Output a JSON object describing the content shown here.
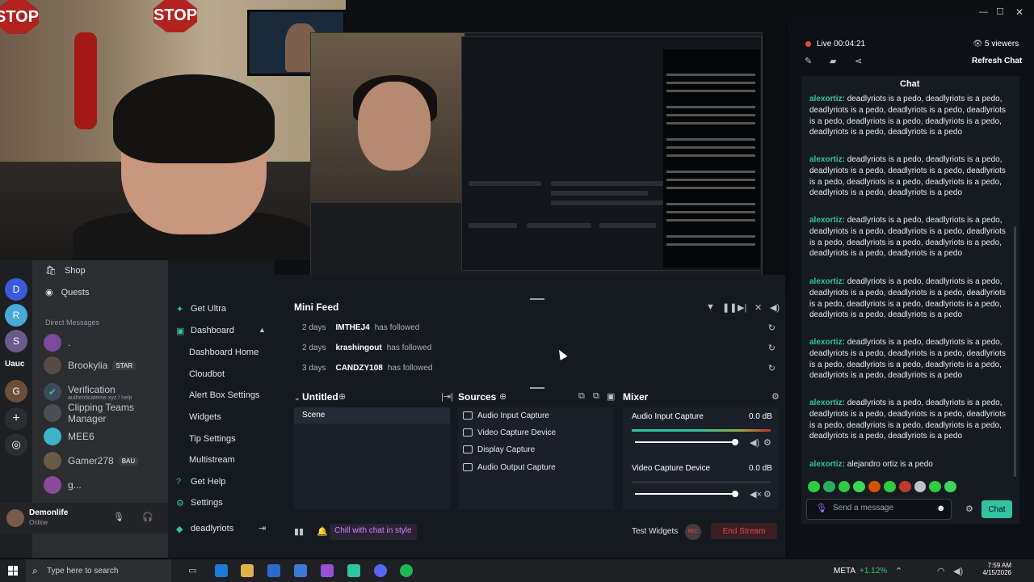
{
  "window": {
    "controls": [
      "—",
      "☐",
      "✕"
    ]
  },
  "stream": {
    "status": "Live",
    "time": "00:04:21",
    "viewers": "5 viewers",
    "refresh": "Refresh Chat",
    "chat_title": "Chat"
  },
  "chat": {
    "messages": [
      {
        "user": "alexortiz",
        "text": "deadlyriots is a pedo, deadlyriots is a pedo, deadlyriots is a pedo, deadlyriots is a pedo, deadlyriots is a pedo, deadlyriots is a pedo, deadlyriots is a pedo, deadlyriots is a pedo, deadlyriots is a pedo"
      },
      {
        "user": "alexortiz",
        "text": "deadlyriots is a pedo, deadlyriots is a pedo, deadlyriots is a pedo, deadlyriots is a pedo, deadlyriots is a pedo, deadlyriots is a pedo, deadlyriots is a pedo, deadlyriots is a pedo, deadlyriots is a pedo"
      },
      {
        "user": "alexortiz",
        "text": "deadlyriots is a pedo, deadlyriots is a pedo, deadlyriots is a pedo, deadlyriots is a pedo, deadlyriots is a pedo, deadlyriots is a pedo, deadlyriots is a pedo, deadlyriots is a pedo, deadlyriots is a pedo"
      },
      {
        "user": "alexortiz",
        "text": "deadlyriots is a pedo, deadlyriots is a pedo, deadlyriots is a pedo, deadlyriots is a pedo, deadlyriots is a pedo, deadlyriots is a pedo, deadlyriots is a pedo, deadlyriots is a pedo, deadlyriots is a pedo"
      },
      {
        "user": "alexortiz",
        "text": "deadlyriots is a pedo, deadlyriots is a pedo, deadlyriots is a pedo, deadlyriots is a pedo, deadlyriots is a pedo, deadlyriots is a pedo, deadlyriots is a pedo, deadlyriots is a pedo, deadlyriots is a pedo"
      },
      {
        "user": "alexortiz",
        "text": "deadlyriots is a pedo, deadlyriots is a pedo, deadlyriots is a pedo, deadlyriots is a pedo, deadlyriots is a pedo, deadlyriots is a pedo, deadlyriots is a pedo, deadlyriots is a pedo, deadlyriots is a pedo"
      },
      {
        "user": "alexortiz",
        "text": "alejandro ortiz is a pedo"
      }
    ],
    "input_placeholder": "Send a message",
    "send_label": "Chat"
  },
  "discord": {
    "items": [
      {
        "label": "Shop"
      },
      {
        "label": "Quests"
      }
    ],
    "dm_header": "Direct Messages",
    "dms": [
      {
        "name": ".",
        "sub": "",
        "badge": ""
      },
      {
        "name": "Brookylia",
        "sub": "",
        "badge": "STAR"
      },
      {
        "name": "Verification",
        "sub": "authenticateme.xyz / help",
        "badge": ""
      },
      {
        "name": "Clipping Teams Manager",
        "sub": "",
        "badge": ""
      },
      {
        "name": "MEE6",
        "sub": "",
        "badge": ""
      },
      {
        "name": "Gamer278",
        "sub": "",
        "badge": "BAU"
      },
      {
        "name": "g...",
        "sub": "",
        "badge": ""
      }
    ],
    "rail_label": "Uauc",
    "user": {
      "name": "Demonlife",
      "status": "Online"
    }
  },
  "obs_nav": {
    "items": [
      {
        "label": "Get Ultra",
        "sub": false
      },
      {
        "label": "Dashboard",
        "sub": false
      },
      {
        "label": "Dashboard Home",
        "sub": true
      },
      {
        "label": "Cloudbot",
        "sub": true
      },
      {
        "label": "Alert Box Settings",
        "sub": true
      },
      {
        "label": "Widgets",
        "sub": true
      },
      {
        "label": "Tip Settings",
        "sub": true
      },
      {
        "label": "Multistream",
        "sub": true
      },
      {
        "label": "Get Help",
        "sub": false
      },
      {
        "label": "Settings",
        "sub": false
      }
    ],
    "account": "deadlyriots"
  },
  "minifeed": {
    "title": "Mini Feed",
    "rows": [
      {
        "time": "2 days",
        "user": "IMTHEJ4",
        "action": "has followed"
      },
      {
        "time": "2 days",
        "user": "krashingout",
        "action": "has followed"
      },
      {
        "time": "3 days",
        "user": "CANDZY108",
        "action": "has followed"
      }
    ]
  },
  "scenes": {
    "title": "Untitled",
    "items": [
      "Scene"
    ]
  },
  "sources": {
    "title": "Sources",
    "items": [
      "Audio Input Capture",
      "Video Capture Device",
      "Display Capture",
      "Audio Output Capture"
    ]
  },
  "mixer": {
    "title": "Mixer",
    "channels": [
      {
        "name": "Audio Input Capture",
        "db": "0.0 dB",
        "level": 0.48
      },
      {
        "name": "Video Capture Device",
        "db": "0.0 dB",
        "level": 0
      }
    ]
  },
  "footer": {
    "style_label": "Chill with chat in style",
    "test_widgets": "Test Widgets",
    "rec": "REC",
    "end_stream": "End Stream"
  },
  "taskbar": {
    "search_placeholder": "Type here to search",
    "ticker": "META",
    "ticker_change": "+1.12%",
    "time": "7:59 AM",
    "date": "4/15/2026"
  },
  "colors": {
    "accent": "#31c3a2",
    "live": "#e74c3c",
    "end": "#e2484b"
  }
}
